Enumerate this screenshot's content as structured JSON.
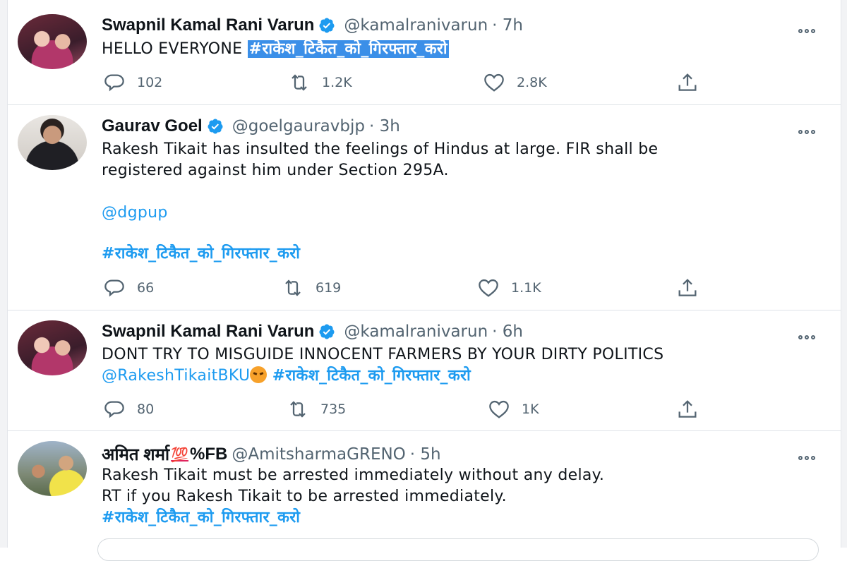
{
  "tweets": [
    {
      "author": "Swapnil Kamal Rani Varun",
      "verified": true,
      "handle": "@kamalranivarun",
      "time": "· 7h",
      "text_plain": "HELLO EVERYONE",
      "text_hashtag": "#राकेश_टिकैत_को_गिरफ्तार_करो",
      "replies": "102",
      "retweets": "1.2K",
      "likes": "2.8K"
    },
    {
      "author": "Gaurav Goel",
      "verified": true,
      "handle": "@goelgauravbjp",
      "time": "· 3h",
      "line1": "Rakesh Tikait has insulted the feelings of Hindus at large. FIR shall be",
      "line2": "registered against him under Section 295A.",
      "mention": "@dgpup",
      "hashtag": "#राकेश_टिकैत_को_गिरफ्तार_करो",
      "replies": "66",
      "retweets": "619",
      "likes": "1.1K"
    },
    {
      "author": "Swapnil Kamal Rani Varun",
      "verified": true,
      "handle": "@kamalranivarun",
      "time": "· 6h",
      "line1": "DONT TRY TO MISGUIDE INNOCENT FARMERS BY YOUR DIRTY POLITICS",
      "mention": "@RakeshTikaitBKU",
      "hashtag": "#राकेश_टिकैत_को_गिरफ्तार_करो",
      "replies": "80",
      "retweets": "735",
      "likes": "1K"
    },
    {
      "author_a": "अमित शर्मा",
      "author_emoji": "💯",
      "author_b": "%FB",
      "handle": "@AmitsharmaGRENO",
      "time": "· 5h",
      "line1": "Rakesh Tikait must be arrested immediately without any delay.",
      "line2": "RT if you Rakesh Tikait to be arrested immediately.",
      "hashtag": "#राकेश_टिकैत_को_गिरफ्तार_करो"
    }
  ],
  "colors": {
    "link": "#1d9bf0",
    "text": "#0f1419",
    "muted": "#536471",
    "selection": "#3b8fe8"
  },
  "icons": [
    "verified-badge-icon",
    "more-icon",
    "reply-icon",
    "retweet-icon",
    "like-icon",
    "share-icon",
    "angry-face-emoji",
    "hundred-points-emoji"
  ]
}
